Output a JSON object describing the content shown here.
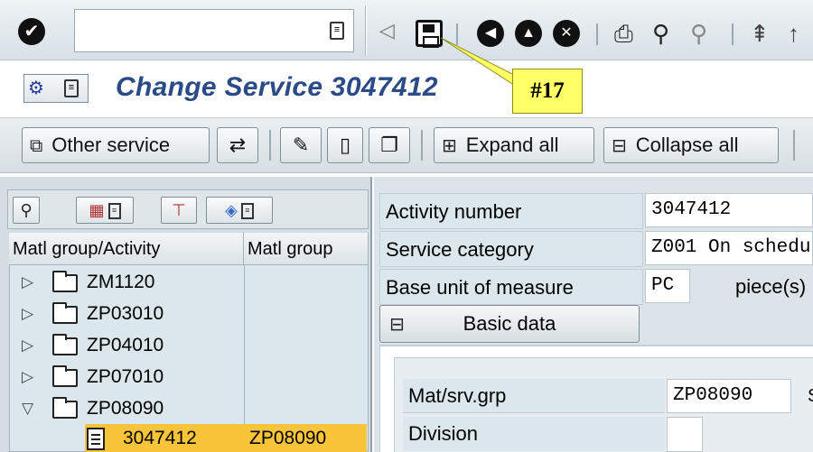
{
  "toolbar": {
    "command_field_value": "",
    "icons": [
      "check-icon",
      "dropdown-icon",
      "back-triangle-icon",
      "save-icon",
      "back-icon",
      "exit-icon",
      "cancel-icon",
      "print-icon",
      "find-icon",
      "find-next-icon",
      "first-page-icon",
      "previous-page-icon"
    ]
  },
  "title": {
    "text": "Change Service 3047412"
  },
  "callout": {
    "label": "#17"
  },
  "app_toolbar": {
    "other_service": "Other service",
    "expand_all": "Expand all",
    "collapse_all": "Collapse all"
  },
  "tree": {
    "headers": [
      "Matl group/Activity",
      "Matl group"
    ],
    "rows": [
      {
        "activity": "ZM1120",
        "group": "",
        "expanded": false
      },
      {
        "activity": "ZP03010",
        "group": "",
        "expanded": false
      },
      {
        "activity": "ZP04010",
        "group": "",
        "expanded": false
      },
      {
        "activity": "ZP07010",
        "group": "",
        "expanded": false
      },
      {
        "activity": "ZP08090",
        "group": "",
        "expanded": true
      }
    ],
    "selected": {
      "activity": "3047412",
      "group": "ZP08090"
    }
  },
  "details": {
    "activity_number_label": "Activity number",
    "activity_number_value": "3047412",
    "service_category_label": "Service category",
    "service_category_value": "Z001 On schedu",
    "base_uom_label": "Base unit of measure",
    "base_uom_value": "PC",
    "base_uom_text": "piece(s)",
    "basic_data_button": "Basic data",
    "matgrp_label": "Mat/srv.grp",
    "matgrp_value": "ZP08090",
    "division_label": "Division",
    "division_value": ""
  },
  "colors": {
    "title": "#2a4a88",
    "callout": "#ffff66",
    "selection": "#f8c53a"
  }
}
